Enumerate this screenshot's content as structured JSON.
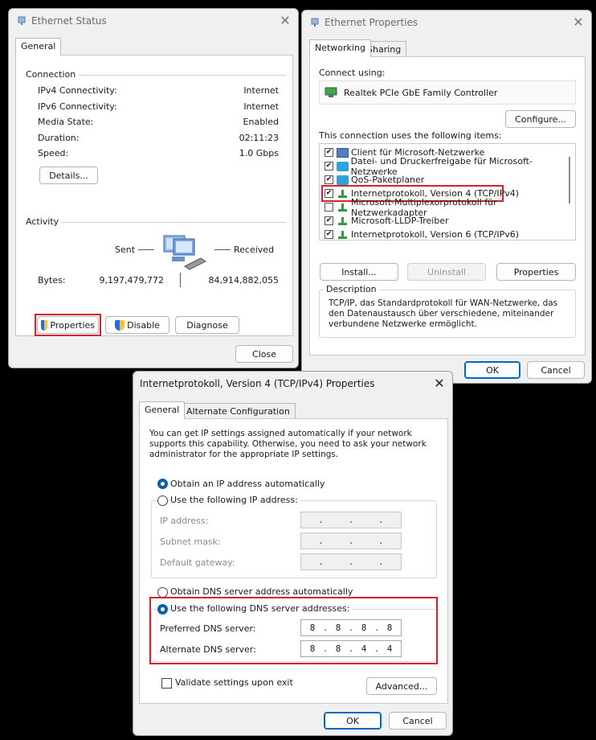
{
  "ethernet_status": {
    "title": "Ethernet Status",
    "tab_general": "General",
    "connection_heading": "Connection",
    "rows": [
      {
        "label": "IPv4 Connectivity:",
        "value": "Internet"
      },
      {
        "label": "IPv6 Connectivity:",
        "value": "Internet"
      },
      {
        "label": "Media State:",
        "value": "Enabled"
      },
      {
        "label": "Duration:",
        "value": "02:11:23"
      },
      {
        "label": "Speed:",
        "value": "1.0 Gbps"
      }
    ],
    "details_button": "Details...",
    "activity_heading": "Activity",
    "sent_label": "Sent",
    "received_label": "Received",
    "bytes_label": "Bytes:",
    "bytes_sent": "9,197,479,772",
    "bytes_received": "84,914,882,055",
    "properties_button": "Properties",
    "disable_button": "Disable",
    "diagnose_button": "Diagnose",
    "close_button": "Close"
  },
  "ethernet_properties": {
    "title": "Ethernet Properties",
    "tab_networking": "Networking",
    "tab_sharing": "Sharing",
    "connect_using_label": "Connect using:",
    "adapter_name": "Realtek PCIe GbE Family Controller",
    "configure_button": "Configure...",
    "items_label": "This connection uses the following items:",
    "items": [
      {
        "label": "Client für Microsoft-Netzwerke",
        "checked": true,
        "icon": "client-icon"
      },
      {
        "label": "Datei- und Druckerfreigabe für Microsoft-Netzwerke",
        "checked": true,
        "icon": "share-icon"
      },
      {
        "label": "QoS-Paketplaner",
        "checked": true,
        "icon": "share-icon"
      },
      {
        "label": "Internetprotokoll, Version 4 (TCP/IPv4)",
        "checked": true,
        "icon": "protocol-icon"
      },
      {
        "label": "Microsoft-Multiplexorprotokoll für Netzwerkadapter",
        "checked": false,
        "icon": "protocol-icon"
      },
      {
        "label": "Microsoft-LLDP-Treiber",
        "checked": true,
        "icon": "protocol-icon"
      },
      {
        "label": "Internetprotokoll, Version 6 (TCP/IPv6)",
        "checked": true,
        "icon": "protocol-icon"
      }
    ],
    "install_button": "Install...",
    "uninstall_button": "Uninstall",
    "properties_button": "Properties",
    "description_heading": "Description",
    "description_text": "TCP/IP, das Standardprotokoll für WAN-Netzwerke, das den Datenaustausch über verschiedene, miteinander verbundene Netzwerke ermöglicht.",
    "ok_button": "OK",
    "cancel_button": "Cancel"
  },
  "ipv4_properties": {
    "title": "Internetprotokoll, Version 4 (TCP/IPv4) Properties",
    "tab_general": "General",
    "tab_alternate": "Alternate Configuration",
    "intro_text": "You can get IP settings assigned automatically if your network supports this capability. Otherwise, you need to ask your network administrator for the appropriate IP settings.",
    "obtain_ip_auto": "Obtain an IP address automatically",
    "use_following_ip": "Use the following IP address:",
    "ip_address_label": "IP address:",
    "subnet_mask_label": "Subnet mask:",
    "default_gateway_label": "Default gateway:",
    "obtain_dns_auto": "Obtain DNS server address automatically",
    "use_following_dns": "Use the following DNS server addresses:",
    "preferred_dns_label": "Preferred DNS server:",
    "alternate_dns_label": "Alternate DNS server:",
    "preferred_dns": [
      "8",
      "8",
      "8",
      "8"
    ],
    "alternate_dns": [
      "8",
      "8",
      "4",
      "4"
    ],
    "validate_label": "Validate settings upon exit",
    "advanced_button": "Advanced...",
    "ok_button": "OK",
    "cancel_button": "Cancel"
  }
}
